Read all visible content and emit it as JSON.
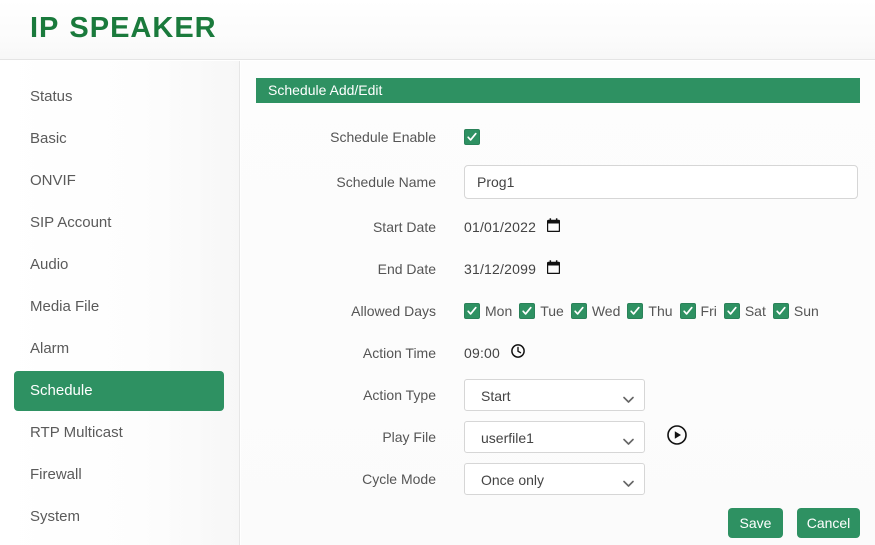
{
  "header": {
    "logo_primary": "IP",
    "logo_secondary": "SPEAKER",
    "logo_color": "#1a7a3c"
  },
  "theme": {
    "accent": "#2e9162",
    "text": "#555555"
  },
  "sidebar": {
    "items": [
      {
        "label": "Status",
        "active": false
      },
      {
        "label": "Basic",
        "active": false
      },
      {
        "label": "ONVIF",
        "active": false
      },
      {
        "label": "SIP Account",
        "active": false
      },
      {
        "label": "Audio",
        "active": false
      },
      {
        "label": "Media File",
        "active": false
      },
      {
        "label": "Alarm",
        "active": false
      },
      {
        "label": "Schedule",
        "active": true
      },
      {
        "label": "RTP Multicast",
        "active": false
      },
      {
        "label": "Firewall",
        "active": false
      },
      {
        "label": "System",
        "active": false
      }
    ]
  },
  "panel": {
    "title": "Schedule Add/Edit"
  },
  "form": {
    "schedule_enable": {
      "label": "Schedule Enable",
      "checked": true
    },
    "schedule_name": {
      "label": "Schedule Name",
      "value": "Prog1",
      "placeholder": ""
    },
    "start_date": {
      "label": "Start Date",
      "value": "01/01/2022",
      "icon": "calendar-icon"
    },
    "end_date": {
      "label": "End Date",
      "value": "31/12/2099",
      "icon": "calendar-icon"
    },
    "allowed_days": {
      "label": "Allowed Days",
      "days": [
        {
          "label": "Mon",
          "checked": true
        },
        {
          "label": "Tue",
          "checked": true
        },
        {
          "label": "Wed",
          "checked": true
        },
        {
          "label": "Thu",
          "checked": true
        },
        {
          "label": "Fri",
          "checked": true
        },
        {
          "label": "Sat",
          "checked": true
        },
        {
          "label": "Sun",
          "checked": true
        }
      ]
    },
    "action_time": {
      "label": "Action Time",
      "value": "09:00",
      "icon": "clock-icon"
    },
    "action_type": {
      "label": "Action Type",
      "value": "Start"
    },
    "play_file": {
      "label": "Play File",
      "value": "userfile1",
      "play_icon": "play-circle-icon"
    },
    "cycle_mode": {
      "label": "Cycle Mode",
      "value": "Once only"
    }
  },
  "actions": {
    "save_label": "Save",
    "cancel_label": "Cancel"
  }
}
